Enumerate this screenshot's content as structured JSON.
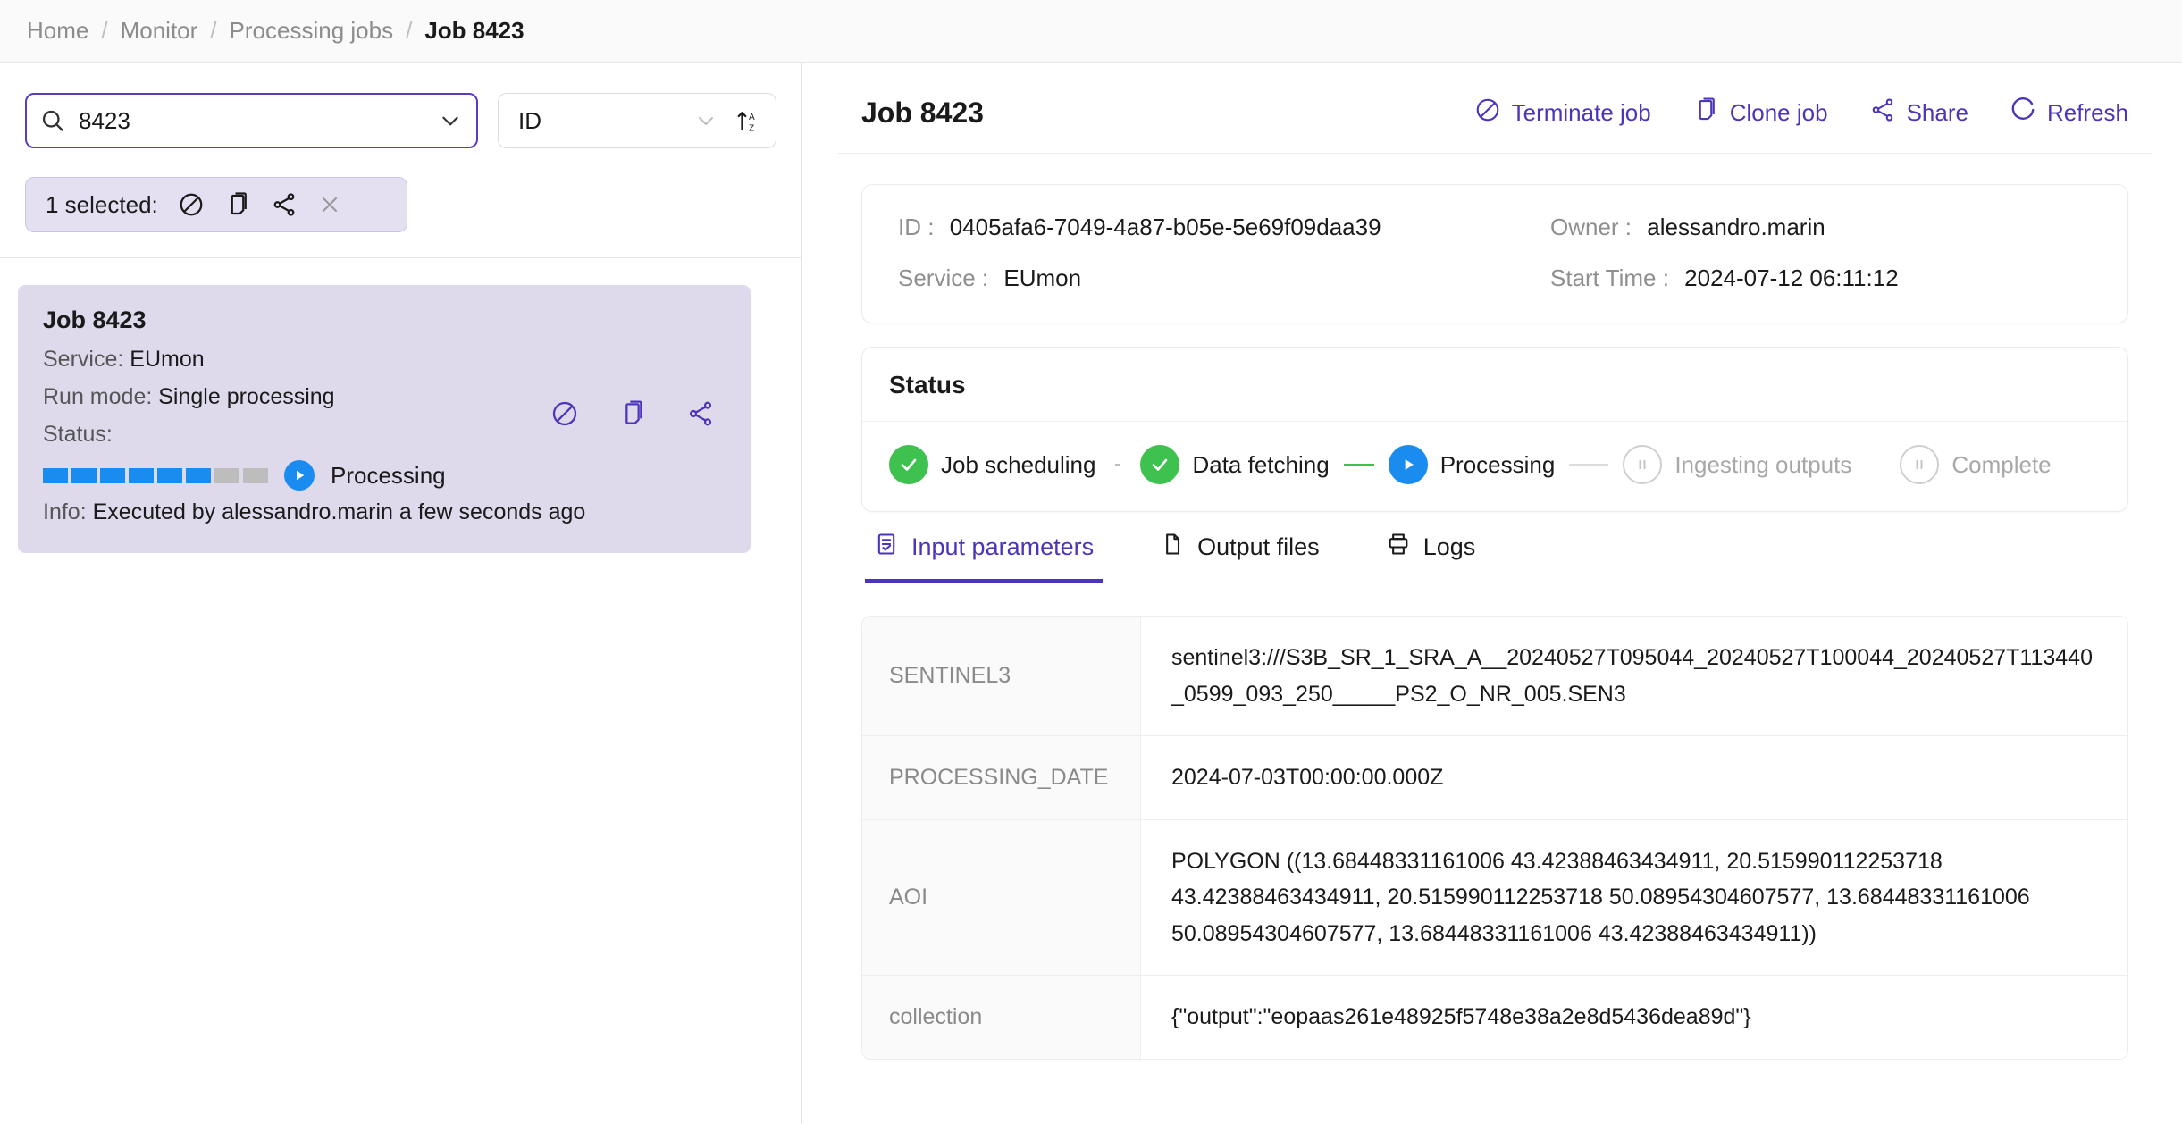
{
  "breadcrumb": {
    "items": [
      {
        "label": "Home",
        "active": false
      },
      {
        "label": "Monitor",
        "active": false
      },
      {
        "label": "Processing jobs",
        "active": false
      },
      {
        "label": "Job 8423",
        "active": true
      }
    ],
    "separator": "/"
  },
  "search": {
    "value": "8423",
    "placeholder": "Search",
    "icon": "search-icon",
    "caret_icon": "chevron-down-icon"
  },
  "filter": {
    "field_label": "ID",
    "caret_icon": "chevron-down-icon",
    "sort_icon": "sort-az-icon"
  },
  "selection_bar": {
    "label": "1 selected:",
    "actions": [
      {
        "name": "terminate",
        "icon": "ban-icon"
      },
      {
        "name": "clone",
        "icon": "copy-icon"
      },
      {
        "name": "share",
        "icon": "share-icon"
      },
      {
        "name": "clear",
        "icon": "close-icon"
      }
    ]
  },
  "job_card": {
    "title": "Job 8423",
    "service_label": "Service:",
    "service_value": "EUmon",
    "run_mode_label": "Run mode:",
    "run_mode_value": "Single processing",
    "status_label": "Status:",
    "progress": {
      "total_segments": 8,
      "filled_segments": 6
    },
    "status_text": "Processing",
    "info_label": "Info:",
    "info_value": "Executed by alessandro.marin a few seconds ago",
    "icons": [
      {
        "name": "terminate",
        "icon": "ban-icon"
      },
      {
        "name": "clone",
        "icon": "copy-icon"
      },
      {
        "name": "share",
        "icon": "share-icon"
      }
    ]
  },
  "detail": {
    "title": "Job 8423",
    "actions": [
      {
        "label": "Terminate job",
        "icon": "ban-icon"
      },
      {
        "label": "Clone job",
        "icon": "copy-icon"
      },
      {
        "label": "Share",
        "icon": "share-icon"
      },
      {
        "label": "Refresh",
        "icon": "refresh-icon"
      }
    ],
    "info": {
      "id_label": "ID :",
      "id_value": "0405afa6-7049-4a87-b05e-5e69f09daa39",
      "owner_label": "Owner :",
      "owner_value": "alessandro.marin",
      "service_label": "Service :",
      "service_value": "EUmon",
      "start_time_label": "Start Time :",
      "start_time_value": "2024-07-12 06:11:12"
    },
    "status": {
      "heading": "Status",
      "steps": [
        {
          "label": "Job scheduling",
          "state": "done",
          "icon": "check-icon"
        },
        {
          "label": "Data fetching",
          "state": "done",
          "icon": "check-icon"
        },
        {
          "label": "Processing",
          "state": "current",
          "icon": "play-icon"
        },
        {
          "label": "Ingesting outputs",
          "state": "pending",
          "icon": "pause-icon"
        },
        {
          "label": "Complete",
          "state": "pending",
          "icon": "pause-icon"
        }
      ]
    },
    "tabs": [
      {
        "label": "Input parameters",
        "icon": "list-check-icon",
        "active": true
      },
      {
        "label": "Output files",
        "icon": "file-icon",
        "active": false
      },
      {
        "label": "Logs",
        "icon": "printer-icon",
        "active": false
      }
    ],
    "parameters": [
      {
        "key": "SENTINEL3",
        "value": "sentinel3:///S3B_SR_1_SRA_A__20240527T095044_20240527T100044_20240527T113440_0599_093_250_____PS2_O_NR_005.SEN3"
      },
      {
        "key": "PROCESSING_DATE",
        "value": "2024-07-03T00:00:00.000Z"
      },
      {
        "key": "AOI",
        "value": "POLYGON ((13.68448331161006 43.42388463434911, 20.515990112253718 43.42388463434911, 20.515990112253718 50.08954304607577, 13.68448331161006 50.08954304607577, 13.68448331161006 43.42388463434911))"
      },
      {
        "key": "collection",
        "value": "{\"output\":\"eopaas261e48925f5748e38a2e8d5436dea89d\"}"
      }
    ]
  },
  "colors": {
    "accent": "#4d35ba",
    "accent_border": "#5b3bc4",
    "selected_bg": "#e4e0f2",
    "card_bg": "#dedaec",
    "success": "#3fc14f",
    "processing": "#1a8cf0",
    "pending": "#cfcfcf"
  }
}
